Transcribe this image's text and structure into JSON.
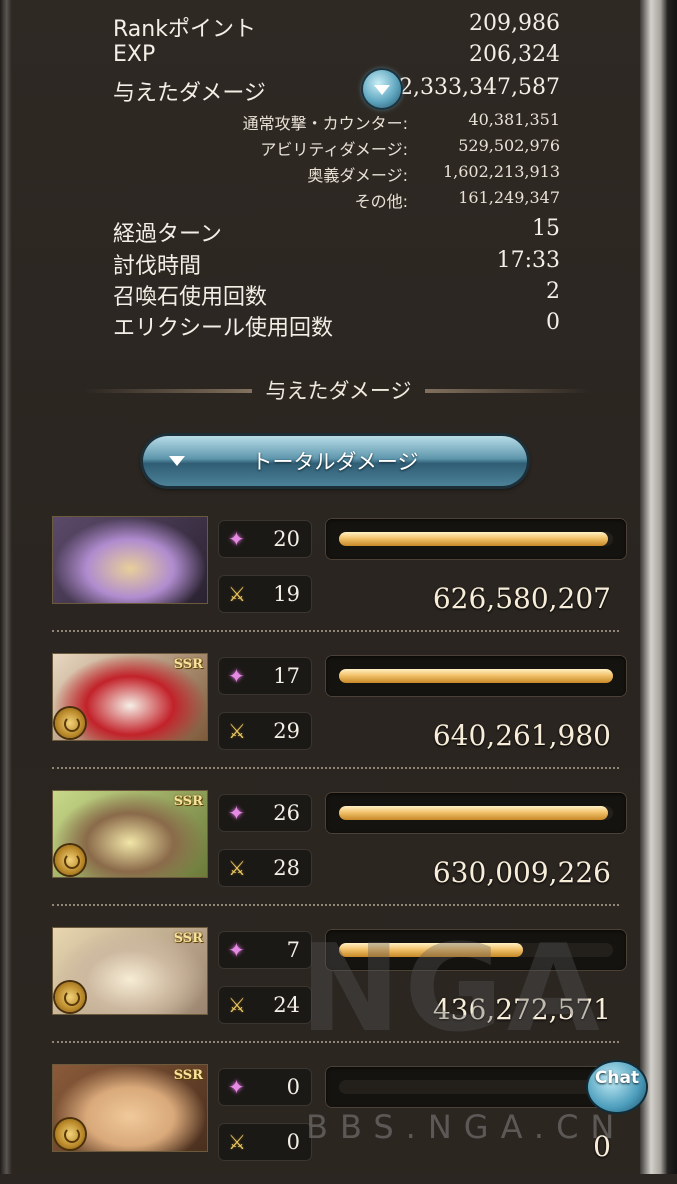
{
  "stats": {
    "rank_points": {
      "label": "Rankポイント",
      "value": "209,986"
    },
    "exp": {
      "label": "EXP",
      "value": "206,324"
    },
    "damage_dealt": {
      "label": "与えたダメージ",
      "value": "2,333,347,587"
    },
    "breakdown": [
      {
        "label": "通常攻撃・カウンター:",
        "value": "40,381,351"
      },
      {
        "label": "アビリティダメージ:",
        "value": "529,502,976"
      },
      {
        "label": "奥義ダメージ:",
        "value": "1,602,213,913"
      },
      {
        "label": "その他:",
        "value": "161,249,347"
      }
    ],
    "turns": {
      "label": "経過ターン",
      "value": "15"
    },
    "time": {
      "label": "討伐時間",
      "value": "17:33"
    },
    "summons_used": {
      "label": "召喚石使用回数",
      "value": "2"
    },
    "elixirs_used": {
      "label": "エリクシール使用回数",
      "value": "0"
    }
  },
  "section_title": "与えたダメージ",
  "dropdown_label": "トータルダメージ",
  "characters": [
    {
      "ssr": "",
      "skills": "20",
      "attacks": "19",
      "damage": "626,580,207",
      "bar_fraction": 0.98,
      "palette": [
        "#5b4a6a",
        "#b08ccf",
        "#e8cf9a",
        "#2a2230"
      ]
    },
    {
      "ssr": "SSR",
      "skills": "17",
      "attacks": "29",
      "damage": "640,261,980",
      "bar_fraction": 1.0,
      "palette": [
        "#e9d8c2",
        "#c2222a",
        "#f5efe6",
        "#7d5a3a"
      ]
    },
    {
      "ssr": "SSR",
      "skills": "26",
      "attacks": "28",
      "damage": "630,009,226",
      "bar_fraction": 0.98,
      "palette": [
        "#c8d98a",
        "#8a6a4a",
        "#f2e6a8",
        "#6b7a3a"
      ]
    },
    {
      "ssr": "SSR",
      "skills": "7",
      "attacks": "24",
      "damage": "436,272,571",
      "bar_fraction": 0.67,
      "palette": [
        "#e8d6b0",
        "#cdb9a0",
        "#f7ecd5",
        "#9a8470"
      ]
    },
    {
      "ssr": "SSR",
      "skills": "0",
      "attacks": "0",
      "damage": "0",
      "bar_fraction": 0.0,
      "palette": [
        "#8a5a3a",
        "#d9a97a",
        "#f0c99a",
        "#4a2f1e"
      ]
    }
  ],
  "icons": {
    "skill": "sparkle-icon",
    "attack": "crossed-swords-icon",
    "expand": "chevron-down-icon"
  },
  "watermark": {
    "logo": "NGA",
    "url": "BBS.NGA.CN"
  },
  "chat_label": "Chat"
}
